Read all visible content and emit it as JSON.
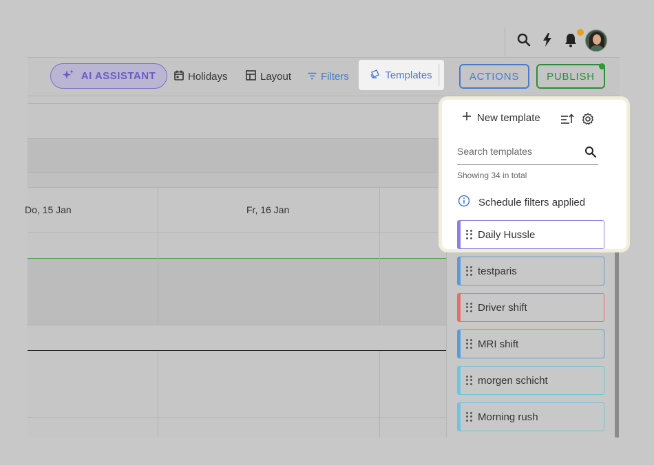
{
  "header": {
    "icons": [
      "search-icon",
      "lightning-icon",
      "bell-icon"
    ],
    "notification_dot_color": "#e8a21a"
  },
  "toolbar": {
    "ai_assistant_label": "AI ASSISTANT",
    "holidays_label": "Holidays",
    "layout_label": "Layout",
    "filters_label": "Filters",
    "templates_label": "Templates",
    "actions_label": "ACTIONS",
    "publish_label": "PUBLISH"
  },
  "calendar": {
    "days": [
      "Do, 15 Jan",
      "Fr, 16 Jan"
    ]
  },
  "templates_panel": {
    "new_template_label": "New template",
    "search_placeholder": "Search templates",
    "showing_text": "Showing 34 in total",
    "filters_notice": "Schedule filters applied",
    "templates": [
      {
        "name": "Daily Hussle",
        "color": "#8b7fe0"
      },
      {
        "name": "testparis",
        "color": "#5b9bd5"
      },
      {
        "name": "Driver shift",
        "color": "#e07070"
      },
      {
        "name": "MRI shift",
        "color": "#5b9bd5"
      },
      {
        "name": "morgen schicht",
        "color": "#6ec4de"
      },
      {
        "name": "Morning rush",
        "color": "#6ec4de"
      }
    ]
  },
  "colors": {
    "accent_blue": "#4a79c9",
    "publish_green": "#2f8a3a",
    "ai_purple": "#6a5cc0"
  }
}
